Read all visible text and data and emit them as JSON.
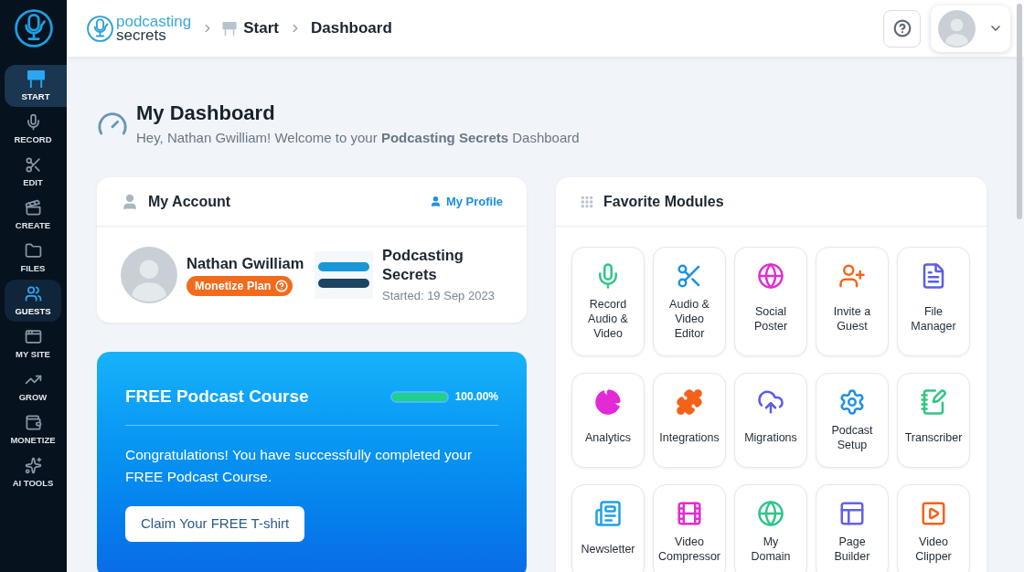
{
  "sidebar": {
    "items": [
      {
        "label": "START",
        "selected": true,
        "hovered": false
      },
      {
        "label": "RECORD",
        "selected": false,
        "hovered": false
      },
      {
        "label": "EDIT",
        "selected": false,
        "hovered": false
      },
      {
        "label": "CREATE",
        "selected": false,
        "hovered": false
      },
      {
        "label": "FILES",
        "selected": false,
        "hovered": false
      },
      {
        "label": "GUESTS",
        "selected": false,
        "hovered": true
      },
      {
        "label": "MY SITE",
        "selected": false,
        "hovered": false
      },
      {
        "label": "GROW",
        "selected": false,
        "hovered": false
      },
      {
        "label": "MONETIZE",
        "selected": false,
        "hovered": false
      },
      {
        "label": "AI TOOLS",
        "selected": false,
        "hovered": false
      }
    ]
  },
  "topbar": {
    "brand": {
      "line_1": "podcasting",
      "line_2": "secrets"
    },
    "breadcrumb": [
      {
        "label": "Start",
        "kind": "link"
      },
      {
        "label": "Dashboard",
        "kind": "current"
      }
    ]
  },
  "page_header": {
    "title": "My Dashboard",
    "subtitle": "Hey, Nathan Gwilliam! Welcome to your **Podcasting Secrets** Dashboard"
  },
  "account_card": {
    "title": "My Account",
    "profile_link": "My Profile",
    "user": {
      "name": "Nathan Gwilliam",
      "plan": "Monetize Plan"
    },
    "podcast": {
      "name": "Podcasting Secrets",
      "started": "Started: 19 Sep 2023"
    }
  },
  "course_card": {
    "title": "FREE Podcast Course",
    "progress": {
      "level": 1,
      "reading": "100.00%"
    },
    "message": "Congratulations! You have successfully completed your FREE Podcast Course.",
    "button": "Claim Your FREE T-shirt"
  },
  "modules_card": {
    "title": "Favorite Modules",
    "modules": [
      {
        "label": "Record\nAudio &\nVideo"
      },
      {
        "label": "Audio &\nVideo\nEditor"
      },
      {
        "label": "Social\nPoster"
      },
      {
        "label": "Invite a\nGuest"
      },
      {
        "label": "File\nManager"
      },
      {
        "label": "Analytics"
      },
      {
        "label": "Integrations"
      },
      {
        "label": "Migrations"
      },
      {
        "label": "Podcast\nSetup"
      },
      {
        "label": "Transcriber"
      },
      {
        "label": "Newsletter"
      },
      {
        "label": "Video\nCompressor"
      },
      {
        "label": "My\nDomain"
      },
      {
        "label": "Page\nBuilder"
      },
      {
        "label": "Video\nClipper"
      }
    ]
  }
}
